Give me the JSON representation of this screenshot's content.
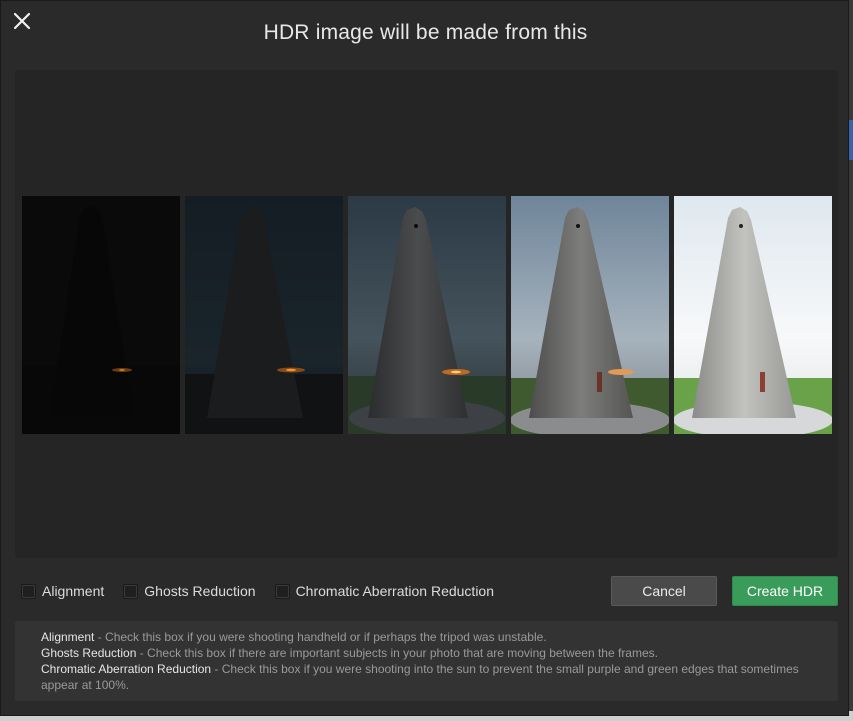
{
  "dialog": {
    "title": "HDR image will be made from this",
    "close_icon": "close-icon"
  },
  "preview": {
    "thumbnails": [
      {
        "alt": "exposure-1"
      },
      {
        "alt": "exposure-2"
      },
      {
        "alt": "exposure-3"
      },
      {
        "alt": "exposure-4"
      },
      {
        "alt": "exposure-5"
      }
    ]
  },
  "options": {
    "alignment": "Alignment",
    "ghosts": "Ghosts Reduction",
    "chromatic": "Chromatic Aberration Reduction"
  },
  "buttons": {
    "cancel": "Cancel",
    "create": "Create HDR"
  },
  "help": {
    "alignment_term": "Alignment",
    "alignment_text": " - Check this box if you were shooting handheld or if perhaps the tripod was unstable.",
    "ghosts_term": "Ghosts Reduction",
    "ghosts_text": " - Check this box if there are important subjects in your photo that are moving between the frames.",
    "chromatic_term": "Chromatic Aberration Reduction",
    "chromatic_text": " - Check this box if you were shooting into the sun to prevent the small purple and green edges that sometimes appear at 100%."
  },
  "colors": {
    "accent_green": "#3a9c5a",
    "dialog_bg": "#2a2a2a",
    "preview_bg": "#252525"
  }
}
